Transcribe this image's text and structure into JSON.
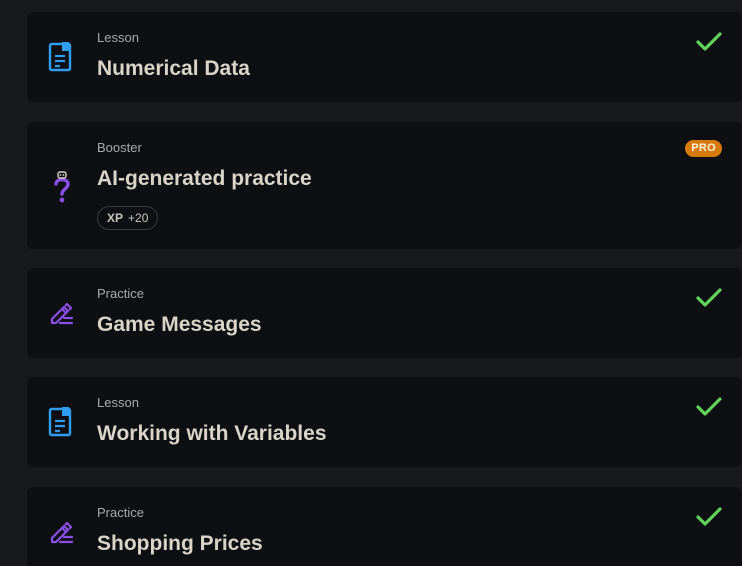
{
  "items": [
    {
      "kind": "Lesson",
      "title": "Numerical Data",
      "icon": "lesson-document-icon",
      "completed": true
    },
    {
      "kind": "Booster",
      "title": "AI-generated practice",
      "icon": "ai-question-icon",
      "badge": "PRO",
      "xp_label": "XP",
      "xp_value": "+20",
      "completed": false
    },
    {
      "kind": "Practice",
      "title": "Game Messages",
      "icon": "practice-pencil-icon",
      "completed": true
    },
    {
      "kind": "Lesson",
      "title": "Working with Variables",
      "icon": "lesson-document-icon",
      "completed": true
    },
    {
      "kind": "Practice",
      "title": "Shopping Prices",
      "icon": "practice-pencil-icon",
      "completed": true
    }
  ],
  "colors": {
    "lesson_icon": "#2f9ef0",
    "practice_icon": "#8a4fe6",
    "booster_icon": "#8a4fe6",
    "check": "#5fd35a",
    "pro_badge": "#d77a0e"
  }
}
